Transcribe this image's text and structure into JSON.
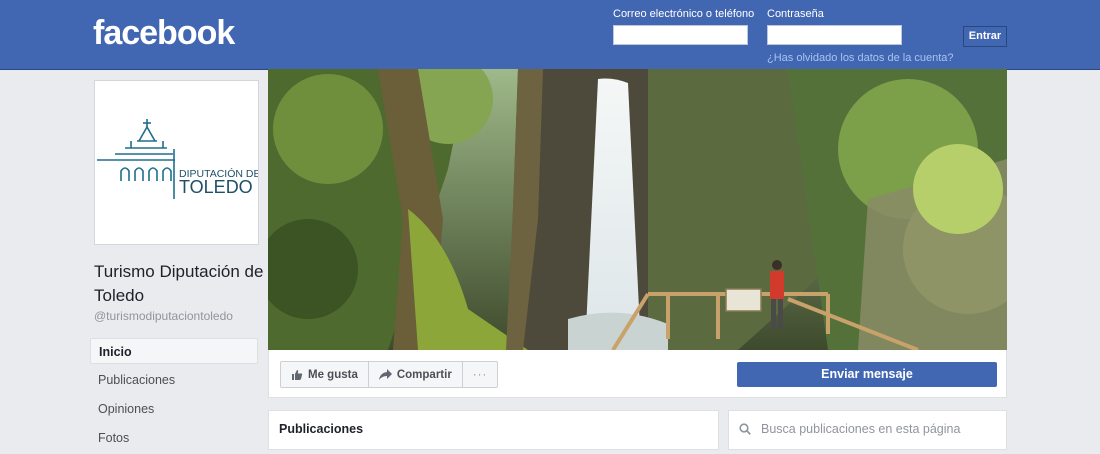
{
  "header": {
    "logo": "facebook",
    "email_label": "Correo electrónico o teléfono",
    "password_label": "Contraseña",
    "login_button": "Entrar",
    "forgot_link": "¿Has olvidado los datos de la cuenta?"
  },
  "profile": {
    "logo_line1": "DIPUTACIÓN DE",
    "logo_line2": "TOLEDO",
    "name": "Turismo Diputación de Toledo",
    "handle": "@turismodiputaciontoledo"
  },
  "sidebar": {
    "items": [
      {
        "label": "Inicio"
      },
      {
        "label": "Publicaciones"
      },
      {
        "label": "Opiniones"
      },
      {
        "label": "Fotos"
      }
    ]
  },
  "actions": {
    "like": "Me gusta",
    "share": "Compartir",
    "more": "···",
    "send_message": "Enviar mensaje"
  },
  "posts": {
    "title": "Publicaciones"
  },
  "search": {
    "placeholder": "Busca publicaciones en esta página"
  },
  "colors": {
    "brand": "#4267b2",
    "background": "#e9ebee"
  }
}
